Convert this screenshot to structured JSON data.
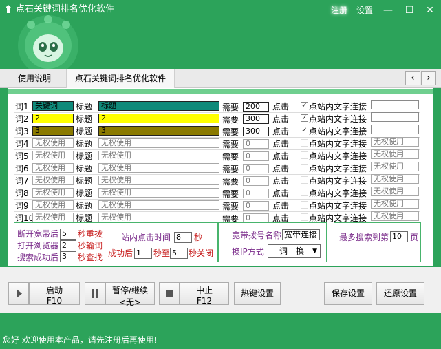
{
  "window": {
    "title": "点石关键词排名优化软件",
    "register_label": "注册",
    "settings_label": "设置",
    "minimize": "—",
    "maximize": "☐",
    "close": "✕"
  },
  "tabs": [
    {
      "label": "使用说明"
    },
    {
      "label": "点石关键词排名优化软件"
    }
  ],
  "tab_nav": {
    "prev": "‹",
    "next": "›"
  },
  "table": {
    "title_label": "标题",
    "need_label": "需要",
    "click_label": "点击",
    "link_label": "点站内文字连接",
    "rows": [
      {
        "name": "词1",
        "keyword": "关键词",
        "title": "标题",
        "need": "200",
        "checked": true,
        "check": "✓",
        "url": ""
      },
      {
        "name": "词2",
        "keyword": "2",
        "title": "2",
        "need": "300",
        "checked": true,
        "check": "✓",
        "url": ""
      },
      {
        "name": "词3",
        "keyword": "3",
        "title": "3",
        "need": "300",
        "checked": true,
        "check": "✓",
        "url": ""
      },
      {
        "name": "词4",
        "keyword": "无权使用",
        "title": "无权使用",
        "need": "0",
        "checked": false,
        "check": "",
        "url": "无权使用"
      },
      {
        "name": "词5",
        "keyword": "无权使用",
        "title": "无权使用",
        "need": "0",
        "checked": false,
        "check": "",
        "url": "无权使用"
      },
      {
        "name": "词6",
        "keyword": "无权使用",
        "title": "无权使用",
        "need": "0",
        "checked": false,
        "check": "",
        "url": "无权使用"
      },
      {
        "name": "词7",
        "keyword": "无权使用",
        "title": "无权使用",
        "need": "0",
        "checked": false,
        "check": "",
        "url": "无权使用"
      },
      {
        "name": "词8",
        "keyword": "无权使用",
        "title": "无权使用",
        "need": "0",
        "checked": false,
        "check": "",
        "url": "无权使用"
      },
      {
        "name": "词9",
        "keyword": "无权使用",
        "title": "无权使用",
        "need": "0",
        "checked": false,
        "check": "",
        "url": "无权使用"
      },
      {
        "name": "词10",
        "keyword": "无权使用",
        "title": "无权使用",
        "need": "0",
        "checked": false,
        "check": "",
        "url": "无权使用"
      }
    ]
  },
  "settings": {
    "disconnect_label": "断开宽带后",
    "disconnect_value": "5",
    "disconnect_unit": "秒重拨",
    "open_browser_label": "打开浏览器",
    "open_browser_value": "2",
    "open_browser_unit": "秒输词",
    "search_success_label": "搜索成功后",
    "search_success_value": "3",
    "search_success_unit": "秒查找",
    "site_click_label": "站内点击时间",
    "site_click_value": "8",
    "site_click_unit": "秒",
    "after_success_label": "成功后",
    "after_from": "1",
    "after_to_label": "秒至",
    "after_to": "5",
    "after_unit": "秒关闭",
    "dial_name_label": "宽带拨号名称",
    "dial_name_value": "宽带连接",
    "ip_mode_label": "换IP方式",
    "ip_mode_value": "一词一换",
    "max_search_label": "最多搜索到第",
    "max_search_value": "10",
    "max_search_unit": "页"
  },
  "buttons": {
    "start_label": "启动",
    "start_key": "F10",
    "pause_label": "暂停/继续",
    "pause_key": "<无>",
    "stop_label": "中止",
    "stop_key": "F12",
    "hotkey": "热键设置",
    "save": "保存设置",
    "restore": "还原设置"
  },
  "status": "您好 欢迎使用本产品，请先注册后再使用!",
  "colors": {
    "brand_green": "#2ca35a",
    "row1_fill": "#0f8a7a",
    "row2_fill": "#ffff00",
    "row3_fill": "#8a7a00"
  }
}
